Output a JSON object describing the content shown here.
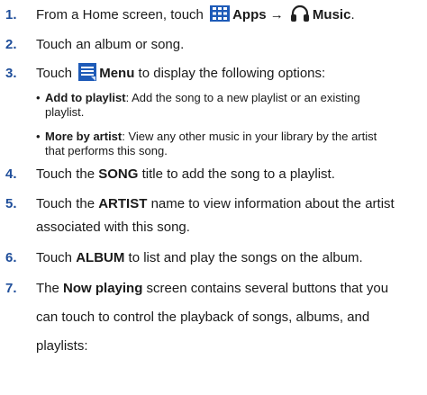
{
  "steps": [
    {
      "num": "1.",
      "pre": "From a Home screen, touch",
      "apps": "Apps",
      "arrow": "→",
      "music": "Music",
      "end": "."
    },
    {
      "num": "2.",
      "text": "Touch an album or song."
    },
    {
      "num": "3.",
      "pre": "Touch",
      "menu": "Menu",
      "post": "to display the following options:"
    },
    {
      "num": "4.",
      "pre": "Touch the",
      "song": "SONG",
      "post": "title to add the song to a playlist."
    },
    {
      "num": "5.",
      "pre": "Touch the",
      "artist": "ARTIST",
      "post": "name to view information about the artist",
      "line2": "associated with this song."
    },
    {
      "num": "6.",
      "pre": "Touch",
      "album": "ALBUM",
      "post": "to list and play the songs on the album."
    },
    {
      "num": "7.",
      "pre": "The",
      "nowplaying": "Now playing",
      "post": "screen contains several buttons that you",
      "line2": "can touch to control the playback of songs, albums, and",
      "line3": "playlists:"
    }
  ],
  "bullets": [
    {
      "dot": "•",
      "label": "Add to playlist",
      "text": ": Add the song to a new playlist or an existing",
      "line2": "playlist."
    },
    {
      "dot": "•",
      "label": "More by artist",
      "text": ": View any other music in your library by the artist",
      "line2": "that performs this song."
    }
  ],
  "icons": {
    "apps": "apps-grid-icon",
    "music": "headphones-icon",
    "menu": "menu-icon"
  },
  "colors": {
    "number": "#1f4e9a",
    "icon_blue": "#1e5bb8"
  }
}
